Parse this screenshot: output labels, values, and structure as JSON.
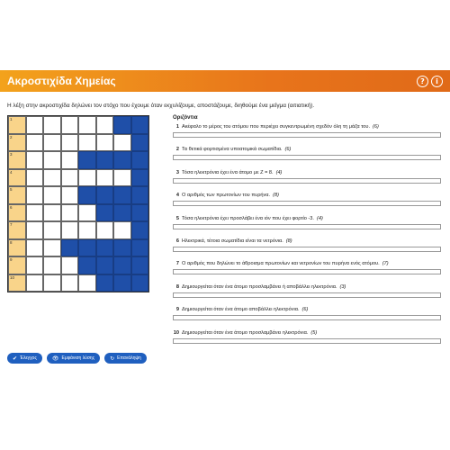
{
  "header": {
    "title": "Ακροστιχίδα Χημείας",
    "help_icon": "?",
    "info_icon": "i"
  },
  "instruction": "Η λέξη στην ακροστιχίδα δηλώνει τον στόχο που έχουμε όταν εκχυλίζουμε, αποστάζουμε, διηθούμε ένα μείγμα (αιτιατική).",
  "grid": {
    "columns": 8,
    "rows": [
      {
        "num": "1",
        "blue_cols": [
          6,
          7
        ]
      },
      {
        "num": "2",
        "blue_cols": [
          7
        ]
      },
      {
        "num": "3",
        "blue_cols": [
          4,
          5,
          6,
          7
        ]
      },
      {
        "num": "4",
        "blue_cols": [
          7
        ]
      },
      {
        "num": "5",
        "blue_cols": [
          4,
          5,
          6,
          7
        ]
      },
      {
        "num": "6",
        "blue_cols": [
          5,
          6,
          7
        ]
      },
      {
        "num": "7",
        "blue_cols": [
          7
        ]
      },
      {
        "num": "8",
        "blue_cols": [
          3,
          4,
          5,
          6,
          7
        ]
      },
      {
        "num": "9",
        "blue_cols": [
          4,
          5,
          6,
          7
        ]
      },
      {
        "num": "10",
        "blue_cols": [
          5,
          6,
          7
        ]
      }
    ],
    "colors": {
      "first_column": "#f9d48a",
      "blocked": "#1f4fa8"
    }
  },
  "clues": {
    "heading": "Οριζόντια",
    "items": [
      {
        "n": "1",
        "text": "Ακέφαλο το μέρος του ατόμου που περιέχει συγκεντρωμένη σχεδόν όλη τη μάζα του.",
        "pts": "(6)",
        "answer": "______"
      },
      {
        "n": "2",
        "text": "Τα θετικά φορτισμένα υποατομικά σωματίδια.",
        "pts": "(6)",
        "answer": "______"
      },
      {
        "n": "3",
        "text": "Τόσα ηλεκτρόνια έχει ένα άτομο με Z = 8.",
        "pts": "(4)",
        "answer": "____"
      },
      {
        "n": "4",
        "text": "Ο αριθμός των πρωτονίων του πυρήνα.",
        "pts": "(8)",
        "answer": "________"
      },
      {
        "n": "5",
        "text": "Τόσα ηλεκτρόνια έχει προσλάβει ένα ιόν που έχει φορτίο -3.",
        "pts": "(4)",
        "answer": "____"
      },
      {
        "n": "6",
        "text": "Ηλεκτρικά, τέτοια σωματίδια είναι τα νετρόνια.",
        "pts": "(8)",
        "answer": "________"
      },
      {
        "n": "7",
        "text": "Ο αριθμός που δηλώνει το άθροισμα πρωτονίων και νετρονίων του πυρήνα ενός ατόμου.",
        "pts": "(7)",
        "answer": "_______"
      },
      {
        "n": "8",
        "text": "Δημιουργείται όταν ένα άτομο προσλαμβάνει ή αποβάλλει ηλεκτρόνια.",
        "pts": "(3)",
        "answer": "___"
      },
      {
        "n": "9",
        "text": "Δημιουργείται όταν ένα άτομο αποβάλλει ηλεκτρόνια.",
        "pts": "(6)",
        "answer": "______"
      },
      {
        "n": "10",
        "text": "Δημιουργείται όταν ένα άτομο προσλαμβάνει ηλεκτρόνια.",
        "pts": "(5)",
        "answer": "_____"
      }
    ]
  },
  "buttons": {
    "check": "Έλεγχος",
    "solution": "Εμφάνιση λύσης",
    "retry": "Επανάληψη"
  }
}
